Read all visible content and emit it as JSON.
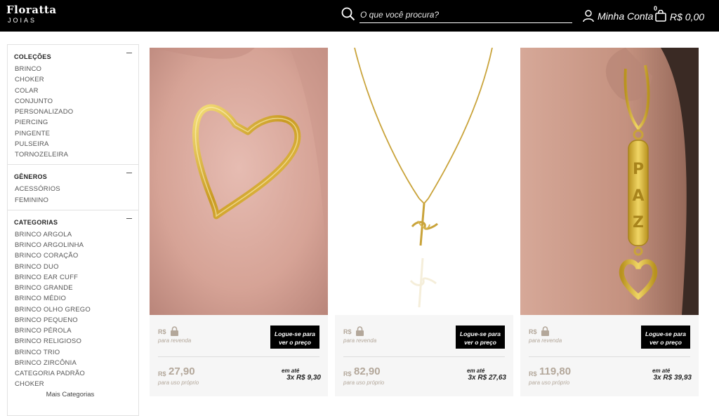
{
  "header": {
    "logo_main": "Floratta",
    "logo_sub": "JOIAS",
    "search_placeholder": "O que você procura?",
    "account_label": "Minha Conta",
    "cart_count": "0",
    "cart_total": "R$ 0,00"
  },
  "sidebar": {
    "groups": [
      {
        "title": "COLEÇÕES",
        "items": [
          "BRINCO",
          "CHOKER",
          "COLAR",
          "CONJUNTO",
          "PERSONALIZADO",
          "PIERCING",
          "PINGENTE",
          "PULSEIRA",
          "TORNOZELEIRA"
        ]
      },
      {
        "title": "GÊNEROS",
        "items": [
          "ACESSÓRIOS",
          "FEMININO"
        ]
      },
      {
        "title": "CATEGORIAS",
        "items": [
          "BRINCO ARGOLA",
          "BRINCO ARGOLINHA",
          "BRINCO CORAÇÃO",
          "BRINCO DUO",
          "BRINCO EAR CUFF",
          "BRINCO GRANDE",
          "BRINCO MÉDIO",
          "BRINCO OLHO GREGO",
          "BRINCO PEQUENO",
          "BRINCO PÉROLA",
          "BRINCO RELIGIOSO",
          "BRINCO TRIO",
          "BRINCO ZIRCÔNIA",
          "CATEGORIA PADRÃO",
          "CHOKER"
        ],
        "more_label": "Mais Categorias"
      }
    ]
  },
  "products": [
    {
      "resale_currency": "R$",
      "resale_label": "para revenda",
      "login_line1": "Logue-se para",
      "login_line2": "ver o preço",
      "price_currency": "R$",
      "price": "27,90",
      "price_label": "para uso próprio",
      "installment_label": "em até",
      "installment": "3x  R$  9,30"
    },
    {
      "resale_currency": "R$",
      "resale_label": "para revenda",
      "login_line1": "Logue-se para",
      "login_line2": "ver o preço",
      "price_currency": "R$",
      "price": "82,90",
      "price_label": "para uso próprio",
      "installment_label": "em até",
      "installment": "3x  R$  27,63"
    },
    {
      "resale_currency": "R$",
      "resale_label": "para revenda",
      "login_line1": "Logue-se para",
      "login_line2": "ver o preço",
      "price_currency": "R$",
      "price": "119,80",
      "price_label": "para uso próprio",
      "installment_label": "em até",
      "installment": "3x  R$  39,93"
    }
  ],
  "colors": {
    "header_bg": "#000000",
    "gold": "#d4b43a",
    "price_muted": "#b3a79a"
  },
  "icons": {
    "search": "search-icon",
    "account": "user-icon",
    "cart": "shopping-bag-icon",
    "lock": "lock-icon",
    "collapse": "minus-icon"
  }
}
